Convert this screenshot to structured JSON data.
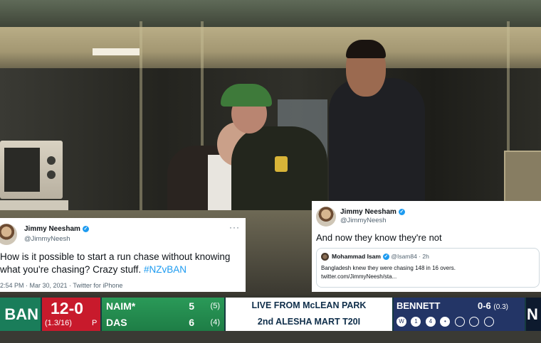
{
  "tweet_left": {
    "name": "Jimmy Neesham",
    "handle": "@JimmyNeesh",
    "more": "···",
    "text": "How is it possible to start a run chase without knowing what you're chasing? Crazy stuff.",
    "hashtag": "#NZvBAN",
    "meta": "2:54 PM · Mar 30, 2021 · Twitter for iPhone"
  },
  "tweet_right": {
    "name": "Jimmy Neesham",
    "handle": "@JimmyNeesh",
    "text": "And now they know they're not",
    "quote": {
      "name": "Mohammad Isam",
      "handle": "@Isam84 · 2h",
      "line1": "Bangladesh knew they were chasing 148 in 16 overs.",
      "line2": "twitter.com/JimmyNeesh/sta..."
    }
  },
  "scorebar": {
    "team_left": "BAN",
    "score": "12-0",
    "overs": "(1.3/16)",
    "powerplay": "P",
    "batters": [
      {
        "name": "NAIM*",
        "runs": "5",
        "balls": "(5)"
      },
      {
        "name": "DAS",
        "runs": "6",
        "balls": "(4)"
      }
    ],
    "venue_line1": "LIVE FROM McLEAN PARK",
    "venue_line2": "2nd ALESHA MART T20I",
    "bowler": {
      "name": "BENNETT",
      "figures": "0-6",
      "overs": "(0.3)"
    },
    "balls": [
      "W",
      "1",
      "4",
      "•",
      "",
      "",
      ""
    ],
    "team_right": "N"
  },
  "colors": {
    "ban_green": "#1a7d5a",
    "score_red": "#c81a2c",
    "batters_green": "#2a9a58",
    "bowler_navy": "#233566",
    "twitter_blue": "#1d9bf0"
  }
}
